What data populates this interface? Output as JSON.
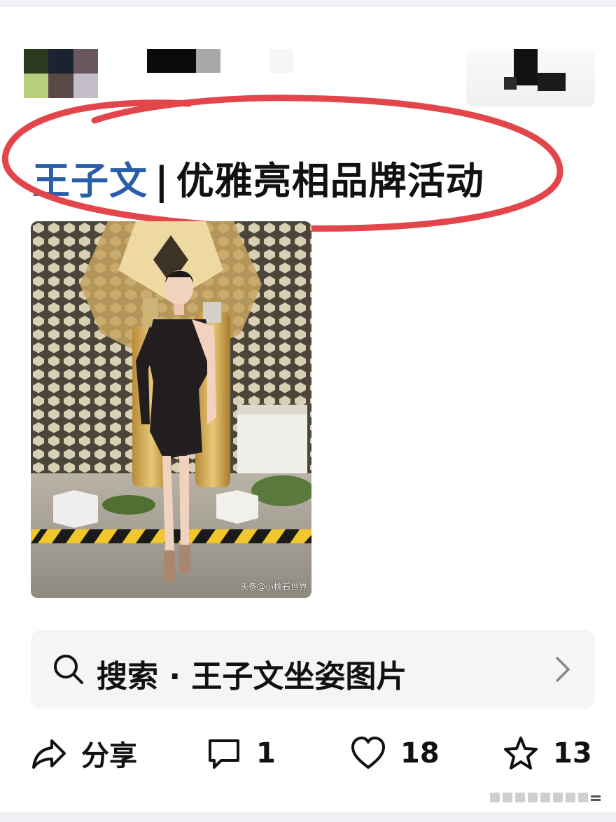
{
  "post": {
    "title_tag": "王子文",
    "title_separator": "|",
    "title_text": "优雅亮相品牌活动",
    "photo_watermark": "头条@小桃石世界"
  },
  "search": {
    "prefix": "搜索",
    "dot": "·",
    "query": "王子文坐姿图片"
  },
  "actions": {
    "share_label": "分享",
    "comment_count": "1",
    "like_count": "18",
    "favorite_count": "13"
  },
  "colors": {
    "title_tag": "#2a5da8",
    "annotation": "#e2464b",
    "search_bg": "#f4f5f7"
  }
}
